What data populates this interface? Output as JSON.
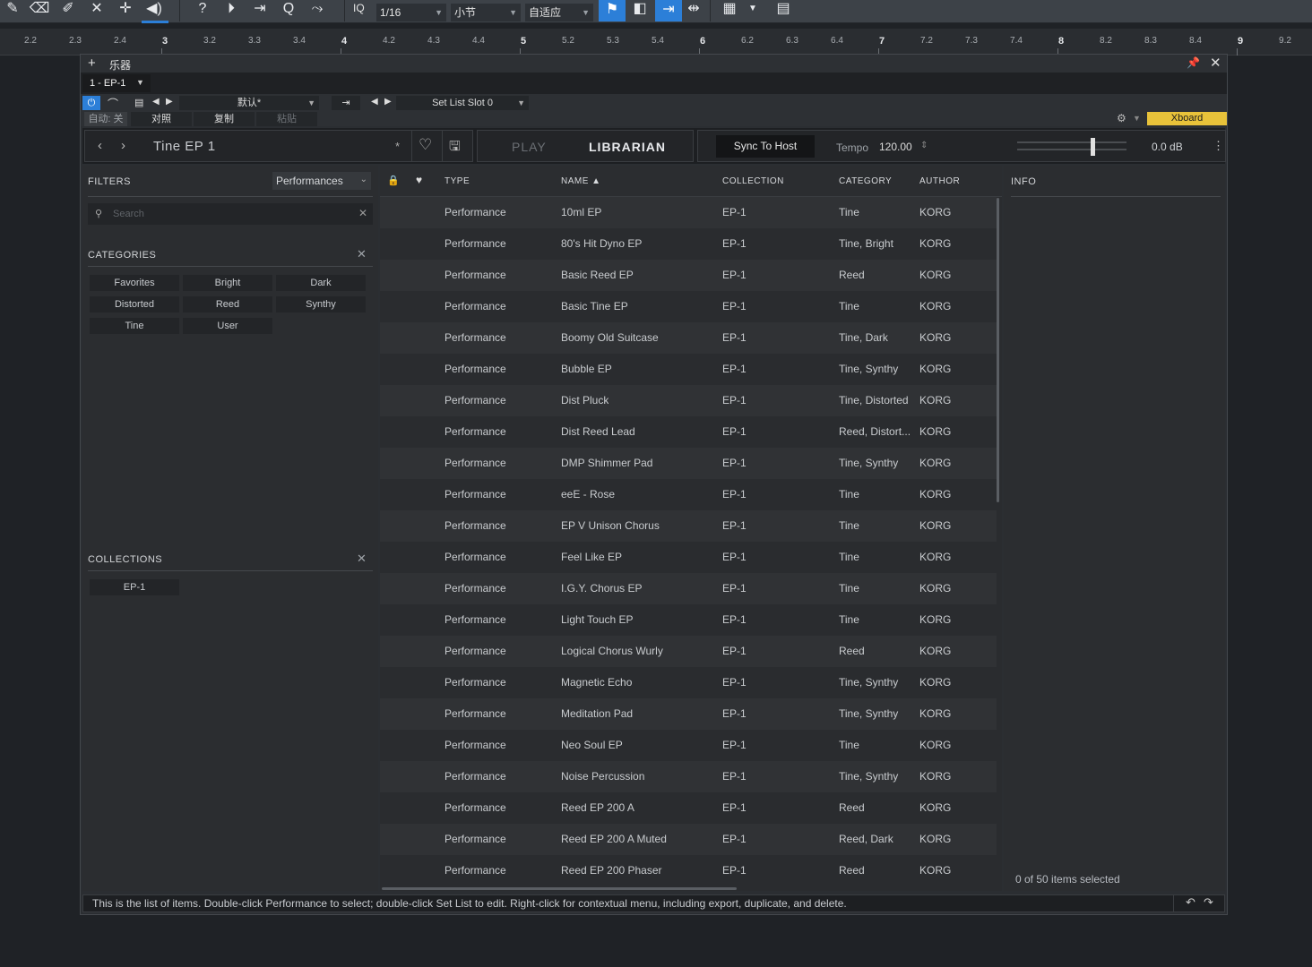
{
  "toolbar": {
    "quantize_label": "IQ",
    "quantize_value": "1/16",
    "timebase_value": "小节",
    "snap_value": "自适应",
    "icons": [
      "pencil-icon",
      "eraser-icon",
      "paint-icon",
      "mute-icon",
      "split-icon",
      "listen-icon",
      "help-icon",
      "follow-icon",
      "loop-icon",
      "zoom-icon",
      "bend-icon"
    ]
  },
  "ruler": {
    "labels": [
      "2.2",
      "2.3",
      "2.4",
      "3",
      "3.2",
      "3.3",
      "3.4",
      "4",
      "4.2",
      "4.3",
      "4.4",
      "5",
      "5.2",
      "5.3",
      "5.4",
      "6",
      "6.2",
      "6.3",
      "6.4",
      "7",
      "7.2",
      "7.3",
      "7.4",
      "8",
      "8.2",
      "8.3",
      "8.4",
      "9",
      "9.2"
    ],
    "majors": [
      "3",
      "4",
      "5",
      "6",
      "7",
      "8",
      "9"
    ]
  },
  "window": {
    "title": "乐器",
    "instrument": "1 - EP-1",
    "preset_name": "默认*",
    "setlist_slot": "Set List Slot 0",
    "auto_label": "自动: 关",
    "compare_label": "对照",
    "copy_label": "复制",
    "paste_label": "粘贴",
    "xboard_label": "Xboard"
  },
  "top": {
    "preset_title": "Tine EP 1",
    "modified_mark": "*",
    "tab_play": "PLAY",
    "tab_librarian": "LIBRARIAN",
    "sync_button": "Sync To Host",
    "tempo_label": "Tempo",
    "tempo_value": "120.00",
    "volume_value": "0.0 dB",
    "volume_level": 0.69
  },
  "filters": {
    "title": "FILTERS",
    "filter_value": "Performances",
    "search_placeholder": "Search",
    "categories_title": "CATEGORIES",
    "categories": [
      "Favorites",
      "Bright",
      "Dark",
      "Distorted",
      "Reed",
      "Synthy",
      "Tine",
      "User"
    ],
    "collections_title": "COLLECTIONS",
    "collections": [
      "EP-1"
    ]
  },
  "list": {
    "headers": {
      "type": "TYPE",
      "name": "NAME ▲",
      "collection": "COLLECTION",
      "category": "CATEGORY",
      "author": "AUTHOR"
    },
    "rows": [
      {
        "type": "Performance",
        "name": "10ml EP",
        "collection": "EP-1",
        "category": "Tine",
        "author": "KORG"
      },
      {
        "type": "Performance",
        "name": "80's Hit Dyno EP",
        "collection": "EP-1",
        "category": "Tine, Bright",
        "author": "KORG"
      },
      {
        "type": "Performance",
        "name": "Basic Reed EP",
        "collection": "EP-1",
        "category": "Reed",
        "author": "KORG"
      },
      {
        "type": "Performance",
        "name": "Basic Tine EP",
        "collection": "EP-1",
        "category": "Tine",
        "author": "KORG"
      },
      {
        "type": "Performance",
        "name": "Boomy Old Suitcase",
        "collection": "EP-1",
        "category": "Tine, Dark",
        "author": "KORG"
      },
      {
        "type": "Performance",
        "name": "Bubble EP",
        "collection": "EP-1",
        "category": "Tine, Synthy",
        "author": "KORG"
      },
      {
        "type": "Performance",
        "name": "Dist Pluck",
        "collection": "EP-1",
        "category": "Tine, Distorted",
        "author": "KORG"
      },
      {
        "type": "Performance",
        "name": "Dist Reed Lead",
        "collection": "EP-1",
        "category": "Reed, Distort...",
        "author": "KORG"
      },
      {
        "type": "Performance",
        "name": "DMP Shimmer Pad",
        "collection": "EP-1",
        "category": "Tine, Synthy",
        "author": "KORG"
      },
      {
        "type": "Performance",
        "name": "eeE - Rose",
        "collection": "EP-1",
        "category": "Tine",
        "author": "KORG"
      },
      {
        "type": "Performance",
        "name": "EP V Unison Chorus",
        "collection": "EP-1",
        "category": "Tine",
        "author": "KORG"
      },
      {
        "type": "Performance",
        "name": "Feel Like EP",
        "collection": "EP-1",
        "category": "Tine",
        "author": "KORG"
      },
      {
        "type": "Performance",
        "name": "I.G.Y. Chorus EP",
        "collection": "EP-1",
        "category": "Tine",
        "author": "KORG"
      },
      {
        "type": "Performance",
        "name": "Light Touch EP",
        "collection": "EP-1",
        "category": "Tine",
        "author": "KORG"
      },
      {
        "type": "Performance",
        "name": "Logical Chorus Wurly",
        "collection": "EP-1",
        "category": "Reed",
        "author": "KORG"
      },
      {
        "type": "Performance",
        "name": "Magnetic Echo",
        "collection": "EP-1",
        "category": "Tine, Synthy",
        "author": "KORG"
      },
      {
        "type": "Performance",
        "name": "Meditation Pad",
        "collection": "EP-1",
        "category": "Tine, Synthy",
        "author": "KORG"
      },
      {
        "type": "Performance",
        "name": "Neo Soul EP",
        "collection": "EP-1",
        "category": "Tine",
        "author": "KORG"
      },
      {
        "type": "Performance",
        "name": "Noise Percussion",
        "collection": "EP-1",
        "category": "Tine, Synthy",
        "author": "KORG"
      },
      {
        "type": "Performance",
        "name": "Reed EP 200 A",
        "collection": "EP-1",
        "category": "Reed",
        "author": "KORG"
      },
      {
        "type": "Performance",
        "name": "Reed EP 200 A Muted",
        "collection": "EP-1",
        "category": "Reed, Dark",
        "author": "KORG"
      },
      {
        "type": "Performance",
        "name": "Reed EP 200 Phaser",
        "collection": "EP-1",
        "category": "Reed",
        "author": "KORG"
      }
    ]
  },
  "info": {
    "title": "INFO",
    "selection": "0 of 50 items selected"
  },
  "status": {
    "text": "This is the list of items. Double-click Performance to select; double-click Set List to edit. Right-click for contextual menu, including export, duplicate, and delete."
  },
  "colors": {
    "accent_blue": "#2c7fd8",
    "xboard_yellow": "#e8c23a"
  }
}
